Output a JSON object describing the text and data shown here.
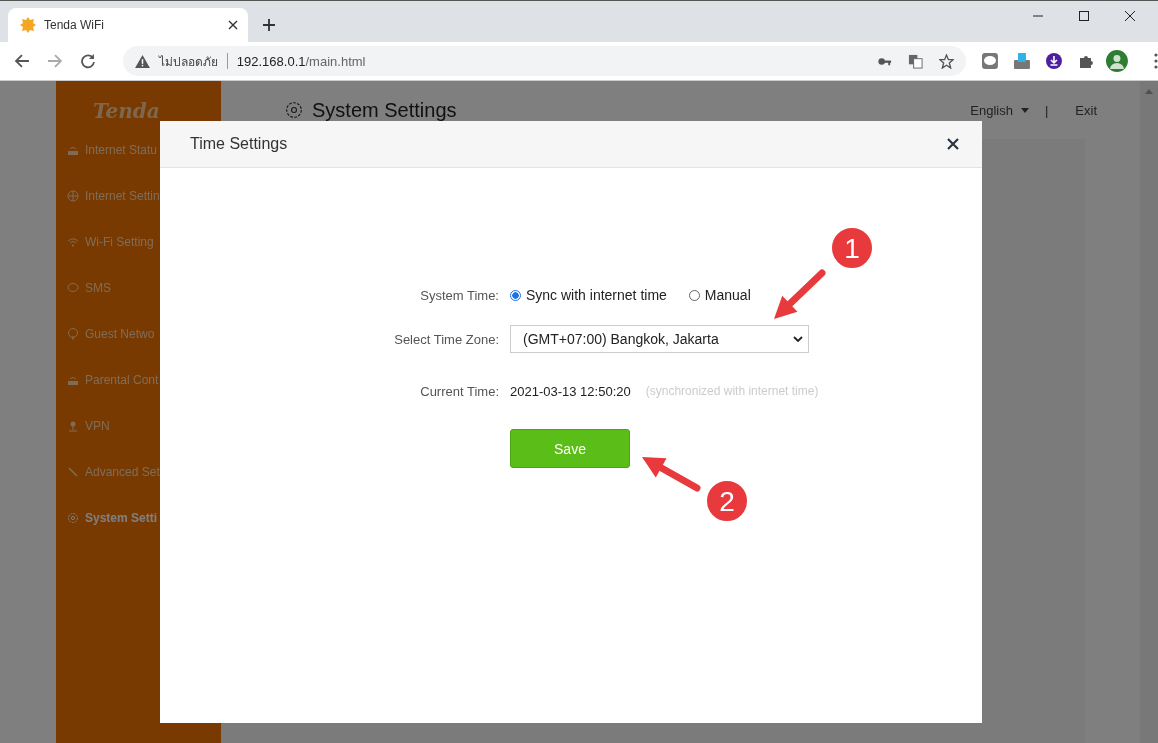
{
  "browser": {
    "tab_title": "Tenda WiFi",
    "security_label": "ไม่ปลอดภัย",
    "url_host": "192.168.0.1",
    "url_path": "/main.html"
  },
  "sidebar": {
    "logo": "Tenda",
    "items": [
      {
        "label": "Internet Statu",
        "selected": false
      },
      {
        "label": "Internet Settin",
        "selected": false
      },
      {
        "label": "Wi-Fi Setting",
        "selected": false
      },
      {
        "label": "SMS",
        "selected": false
      },
      {
        "label": "Guest Netwo",
        "selected": false
      },
      {
        "label": "Parental Cont",
        "selected": false
      },
      {
        "label": "VPN",
        "selected": false
      },
      {
        "label": "Advanced Set",
        "selected": false
      },
      {
        "label": "System Setti",
        "selected": true
      }
    ]
  },
  "header": {
    "title": "System Settings",
    "language": "English",
    "separator": "|",
    "exit": "Exit"
  },
  "dialog": {
    "title": "Time Settings",
    "system_time": {
      "label": "System Time:",
      "options": [
        {
          "label": "Sync with internet time",
          "selected": true
        },
        {
          "label": "Manual",
          "selected": false
        }
      ]
    },
    "time_zone": {
      "label": "Select Time Zone:",
      "value": "(GMT+07:00) Bangkok, Jakarta"
    },
    "current_time": {
      "label": "Current Time:",
      "value": "2021-03-13 12:50:20",
      "note": "(synchronized with internet time)"
    },
    "save": "Save"
  },
  "annotations": [
    {
      "number": "1"
    },
    {
      "number": "2"
    }
  ]
}
